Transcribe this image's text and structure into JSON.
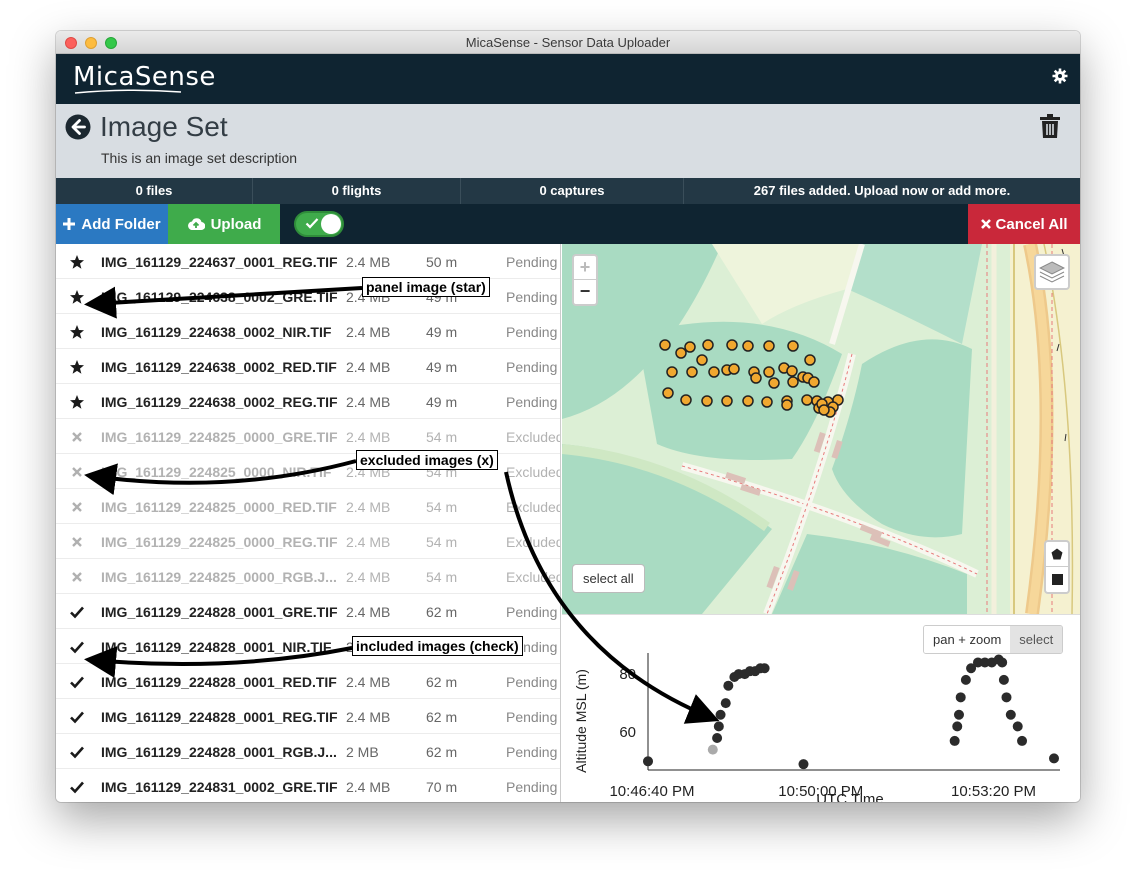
{
  "window": {
    "title": "MicaSense - Sensor Data Uploader"
  },
  "header": {
    "logo": "MicaSense"
  },
  "image_set": {
    "title": "Image Set",
    "description": "This is an image set description"
  },
  "stats": [
    "0 files",
    "0 flights",
    "0 captures",
    "267 files added. Upload now or add more."
  ],
  "toolbar": {
    "add_folder": "Add Folder",
    "upload": "Upload",
    "cancel_all": "Cancel All"
  },
  "files": [
    {
      "icon": "star",
      "name": "IMG_161129_224637_0001_REG.TIF",
      "size": "2.4 MB",
      "alt": "50 m",
      "status": "Pending"
    },
    {
      "icon": "star",
      "name": "IMG_161129_224638_0002_GRE.TIF",
      "size": "2.4 MB",
      "alt": "49 m",
      "status": "Pending"
    },
    {
      "icon": "star",
      "name": "IMG_161129_224638_0002_NIR.TIF",
      "size": "2.4 MB",
      "alt": "49 m",
      "status": "Pending"
    },
    {
      "icon": "star",
      "name": "IMG_161129_224638_0002_RED.TIF",
      "size": "2.4 MB",
      "alt": "49 m",
      "status": "Pending"
    },
    {
      "icon": "star",
      "name": "IMG_161129_224638_0002_REG.TIF",
      "size": "2.4 MB",
      "alt": "49 m",
      "status": "Pending"
    },
    {
      "icon": "x",
      "name": "IMG_161129_224825_0000_GRE.TIF",
      "size": "2.4 MB",
      "alt": "54 m",
      "status": "Excluded"
    },
    {
      "icon": "x",
      "name": "IMG_161129_224825_0000_NIR.TIF",
      "size": "2.4 MB",
      "alt": "54 m",
      "status": "Excluded"
    },
    {
      "icon": "x",
      "name": "IMG_161129_224825_0000_RED.TIF",
      "size": "2.4 MB",
      "alt": "54 m",
      "status": "Excluded"
    },
    {
      "icon": "x",
      "name": "IMG_161129_224825_0000_REG.TIF",
      "size": "2.4 MB",
      "alt": "54 m",
      "status": "Excluded"
    },
    {
      "icon": "x",
      "name": "IMG_161129_224825_0000_RGB.J...",
      "size": "2.4 MB",
      "alt": "54 m",
      "status": "Excluded"
    },
    {
      "icon": "check",
      "name": "IMG_161129_224828_0001_GRE.TIF",
      "size": "2.4 MB",
      "alt": "62 m",
      "status": "Pending"
    },
    {
      "icon": "check",
      "name": "IMG_161129_224828_0001_NIR.TIF",
      "size": "2.4 MB",
      "alt": "62 m",
      "status": "Pending"
    },
    {
      "icon": "check",
      "name": "IMG_161129_224828_0001_RED.TIF",
      "size": "2.4 MB",
      "alt": "62 m",
      "status": "Pending"
    },
    {
      "icon": "check",
      "name": "IMG_161129_224828_0001_REG.TIF",
      "size": "2.4 MB",
      "alt": "62 m",
      "status": "Pending"
    },
    {
      "icon": "check",
      "name": "IMG_161129_224828_0001_RGB.J...",
      "size": "2 MB",
      "alt": "62 m",
      "status": "Pending"
    },
    {
      "icon": "check",
      "name": "IMG_161129_224831_0002_GRE.TIF",
      "size": "2.4 MB",
      "alt": "70 m",
      "status": "Pending"
    }
  ],
  "map": {
    "zoom_in": "+",
    "zoom_out": "−",
    "select_all": "select all"
  },
  "chart_modes": [
    "pan + zoom",
    "select"
  ],
  "chart_data": {
    "type": "scatter",
    "xlabel": "UTC Time",
    "ylabel": "Altitude MSL (m)",
    "xticks": [
      "10:46:40 PM",
      "10:50:00 PM",
      "10:53:20 PM"
    ],
    "yticks": [
      60,
      80
    ],
    "x_unit": "seconds after 10:46:40 PM",
    "xlim": [
      0,
      470
    ],
    "ylim": [
      47,
      90
    ],
    "points": [
      [
        0,
        50
      ],
      [
        75,
        54
      ],
      [
        80,
        58
      ],
      [
        82,
        62
      ],
      [
        84,
        66
      ],
      [
        90,
        70
      ],
      [
        93,
        76
      ],
      [
        100,
        79
      ],
      [
        105,
        80
      ],
      [
        112,
        80
      ],
      [
        118,
        81
      ],
      [
        124,
        81
      ],
      [
        130,
        82
      ],
      [
        135,
        82
      ],
      [
        180,
        49
      ],
      [
        355,
        57
      ],
      [
        358,
        62
      ],
      [
        360,
        66
      ],
      [
        362,
        72
      ],
      [
        368,
        78
      ],
      [
        374,
        82
      ],
      [
        382,
        84
      ],
      [
        390,
        84
      ],
      [
        398,
        84
      ],
      [
        406,
        85
      ],
      [
        410,
        84
      ],
      [
        412,
        78
      ],
      [
        415,
        72
      ],
      [
        420,
        66
      ],
      [
        428,
        62
      ],
      [
        433,
        57
      ],
      [
        470,
        51
      ]
    ],
    "highlighted": [
      [
        75,
        54
      ]
    ]
  },
  "annotations": [
    "panel image (star)",
    "excluded images (x)",
    "included images (check)"
  ],
  "colors": {
    "header": "#0f2431",
    "add_folder": "#2b79c2",
    "upload": "#3fab4b",
    "cancel": "#c9283a",
    "marker": "#f0a830"
  }
}
